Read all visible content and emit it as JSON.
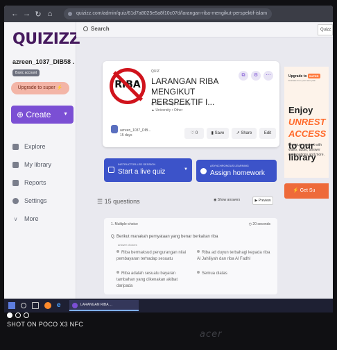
{
  "browser": {
    "url": "quizizz.com/admin/quiz/61d7a8025e5a8f10c07d/larangan-riba-mengikut-perspektif-islam"
  },
  "sidebar": {
    "logo": "QUIZIZZ",
    "username": "azreen_1037_DIB58 .",
    "account_badge": "Basic account",
    "upgrade_label": "Upgrade to super ⚡",
    "create_label": "Create",
    "items": [
      {
        "label": "Explore",
        "icon": "compass-icon"
      },
      {
        "label": "My library",
        "icon": "library-icon"
      },
      {
        "label": "Reports",
        "icon": "reports-icon"
      },
      {
        "label": "Settings",
        "icon": "gear-icon"
      },
      {
        "label": "More",
        "icon": "chevron-down-icon"
      }
    ]
  },
  "topbar": {
    "search_placeholder": "Search",
    "right_button": "Quizz"
  },
  "quiz": {
    "type": "QUIZ",
    "thumbnail_text": "RIBA",
    "title": "LARANGAN RIBA MENGIKUT PERSPEKTIF I...",
    "accuracy": "90% average accuracy",
    "meta": "University • Other",
    "author": "azreen_1037_DIB...",
    "author_time": "15 days",
    "likes": "0",
    "save_label": "Save",
    "share_label": "Share",
    "edit_label": "Edit"
  },
  "actions": {
    "live_small": "INSTRUCTOR-LED SESSION",
    "live_main": "Start a live quiz",
    "hw_small": "ASYNCHRONOUS LEARNING",
    "hw_main": "Assign homework"
  },
  "questions": {
    "count_label": "15 questions",
    "show_answers": "Show answers",
    "preview": "Preview",
    "items": [
      {
        "type_label": "1. Multiple-choice",
        "time_label": "20 seconds",
        "question": "Q. Berikut manakah pernyataan yang benar berkaitan riba",
        "choices_label": "answer choices",
        "options": [
          "Riba bermaksud pengurangan nilai pembayaran terhadap sesuatu",
          "Riba ad duyun terbahagi kepada riba Al Jahiliyah dan riba Al Fadhl",
          "Riba adalah sesuatu bayaran tambahan yang dikenakan akibat daripada",
          "Semua diatas"
        ]
      }
    ]
  },
  "promo": {
    "upgrade_text": "Upgrade to",
    "super_pill": "SUPER",
    "sub_text": "Evaluate from your team plan",
    "headline_1": "Enjoy",
    "headline_hl": "UNREST ACCESS",
    "headline_2": "to our library",
    "description": "Premium content with video, audio, answer explanations and more.",
    "cta": "⚡ Get Su"
  },
  "taskbar": {
    "app_label": "LARANGAN RIBA ..."
  },
  "watermark": {
    "text": "SHOT ON POCO X3 NFC"
  },
  "monitor_brand": "acer",
  "colors": {
    "accent": "#7b4fd4",
    "primary_button": "#3c53c9",
    "promo_orange": "#ee6a3a",
    "logo": "#461a5e"
  }
}
